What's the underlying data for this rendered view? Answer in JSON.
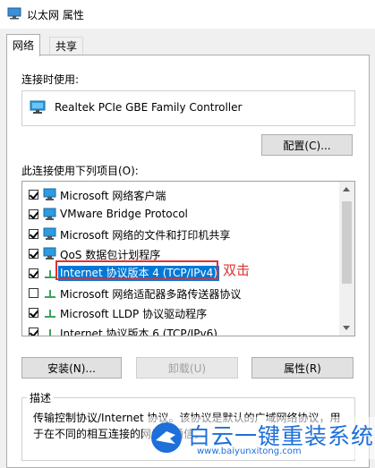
{
  "window": {
    "title": "以太网 属性"
  },
  "tabs": [
    {
      "label": "网络"
    },
    {
      "label": "共享"
    }
  ],
  "connect_using": {
    "label": "连接时使用:",
    "adapter_name": "Realtek PCIe GBE Family Controller",
    "configure_button": "配置(C)..."
  },
  "items_section": {
    "label": "此连接使用下列项目(O):",
    "items": [
      {
        "text": "Microsoft 网络客户端",
        "checked": true,
        "icon": "network-client-icon"
      },
      {
        "text": "VMware Bridge Protocol",
        "checked": true,
        "icon": "network-service-icon"
      },
      {
        "text": "Microsoft 网络的文件和打印机共享",
        "checked": true,
        "icon": "network-service-icon"
      },
      {
        "text": "QoS 数据包计划程序",
        "checked": true,
        "icon": "network-service-icon"
      },
      {
        "text": "Internet 协议版本 4 (TCP/IPv4)",
        "checked": true,
        "icon": "protocol-icon",
        "selected": true
      },
      {
        "text": "Microsoft 网络适配器多路传送器协议",
        "checked": false,
        "icon": "protocol-icon"
      },
      {
        "text": "Microsoft LLDP 协议驱动程序",
        "checked": true,
        "icon": "protocol-icon"
      },
      {
        "text": "Internet 协议版本 6 (TCP/IPv6)",
        "checked": true,
        "icon": "protocol-icon"
      }
    ]
  },
  "annotation": {
    "text": "双击",
    "color": "#e03030"
  },
  "buttons": {
    "install": "安装(N)...",
    "uninstall": "卸载(U)",
    "properties": "属性(R)"
  },
  "description": {
    "legend": "描述",
    "text": "传输控制协议/Internet 协议。该协议是默认的广域网络协议，用于在不同的相互连接的网络上通信。"
  },
  "watermark": {
    "text": "白云一键重装系统",
    "url": "www.baiyunxitong.com"
  },
  "colors": {
    "selection": "#0078d7",
    "accent_red": "#e03030",
    "watermark_blue": "#1e6fd9"
  }
}
